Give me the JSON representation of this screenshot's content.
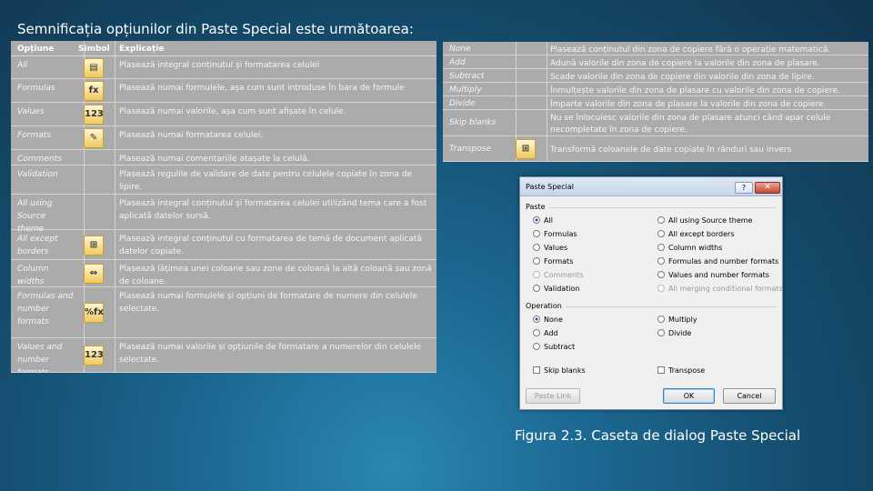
{
  "title": "Semnificația opțiunilor din Paste Special este următoarea:",
  "caption": "Figura 2.3. Caseta de dialog Paste Special",
  "left_table": {
    "headers": {
      "option": "Opțiune",
      "symbol": "Simbol",
      "explanation": "Explicație"
    },
    "rows": [
      {
        "option": "All",
        "icon": "paste-all-icon",
        "glyph": "▤",
        "explanation": "Plasează integral conținutul și formatarea celulei"
      },
      {
        "option": "Formulas",
        "icon": "paste-formulas-icon",
        "glyph": "fx",
        "explanation": "Plasează numai formulele, așa cum sunt introduse în bara de formule"
      },
      {
        "option": "Values",
        "icon": "paste-values-icon",
        "glyph": "123",
        "explanation": "Plasează numai valorile, așa cum sunt afișate în celule."
      },
      {
        "option": "Formats",
        "icon": "paste-formats-icon",
        "glyph": "✎",
        "explanation": "Plasează numai formatarea celulei."
      },
      {
        "option": "Comments",
        "icon": "",
        "glyph": "",
        "explanation": "Plasează numai comentariile atașate la celulă."
      },
      {
        "option": "Validation",
        "icon": "",
        "glyph": "",
        "explanation": "Plasează regulile de validare de date pentru celulele copiate în zona de lipire."
      },
      {
        "option": "All using Source theme",
        "icon": "",
        "glyph": "",
        "explanation": "Plasează integral conținutul și formatarea celulei utilizând tema care a fost aplicată datelor sursă."
      },
      {
        "option": "All except borders",
        "icon": "paste-no-borders-icon",
        "glyph": "⊞",
        "explanation": "Plasează integral conținutul cu formatarea de temă de document aplicată datelor copiate."
      },
      {
        "option": "Column widths",
        "icon": "paste-column-widths-icon",
        "glyph": "⇔",
        "explanation": "Plasează lățimea unei coloane sau zone de coloană la altă coloană sau zonă de coloane."
      },
      {
        "option": "Formulas and number formats",
        "icon": "paste-formulas-number-formats-icon",
        "glyph": "%fx",
        "explanation": "Plasează numai formulele și opțiuni de formatare de numere din celulele selectate."
      },
      {
        "option": "Values and number formats",
        "icon": "paste-values-number-formats-icon",
        "glyph": "123",
        "explanation": "Plasează numai valorile și opțiunile de formatare a numerelor din celulele selectate."
      }
    ]
  },
  "right_table": {
    "rows": [
      {
        "option": "None",
        "icon": "",
        "glyph": "",
        "explanation": "Plasează conținutul din zona de copiere fără o operație matematică."
      },
      {
        "option": "Add",
        "icon": "",
        "glyph": "",
        "explanation": "Adună valorile din zona de copiere la valorile din zona de plasare."
      },
      {
        "option": "Subtract",
        "icon": "",
        "glyph": "",
        "explanation": "Scade valorile din zona de copiere din valorile din zona de lipire."
      },
      {
        "option": "Multiply",
        "icon": "",
        "glyph": "",
        "explanation": "Înmulțește valorile din zona de plasare cu valorile din zona de copiere."
      },
      {
        "option": "Divide",
        "icon": "",
        "glyph": "",
        "explanation": "Împarte valorile din zona de plasare la valorile din zona de copiere."
      },
      {
        "option": "Skip blanks",
        "icon": "",
        "glyph": "",
        "explanation": "Nu se înlocuiesc valorile din zona de plasare atunci când apar celule necompletate în zona de copiere."
      },
      {
        "option": "Transpose",
        "icon": "transpose-icon",
        "glyph": "⊞",
        "explanation": "Transformă coloanele de date copiate în rânduri sau invers"
      }
    ]
  },
  "dialog": {
    "title": "Paste Special",
    "help_label": "?",
    "close_label": "✕",
    "paste_group_label": "Paste",
    "operation_group_label": "Operation",
    "paste_col1": [
      {
        "label": "All",
        "checked": true,
        "disabled": false
      },
      {
        "label": "Formulas",
        "checked": false,
        "disabled": false
      },
      {
        "label": "Values",
        "checked": false,
        "disabled": false
      },
      {
        "label": "Formats",
        "checked": false,
        "disabled": false
      },
      {
        "label": "Comments",
        "checked": false,
        "disabled": true
      },
      {
        "label": "Validation",
        "checked": false,
        "disabled": false
      }
    ],
    "paste_col2": [
      {
        "label": "All using Source theme",
        "checked": false,
        "disabled": false
      },
      {
        "label": "All except borders",
        "checked": false,
        "disabled": false
      },
      {
        "label": "Column widths",
        "checked": false,
        "disabled": false
      },
      {
        "label": "Formulas and number formats",
        "checked": false,
        "disabled": false
      },
      {
        "label": "Values and number formats",
        "checked": false,
        "disabled": false
      },
      {
        "label": "All merging conditional formats",
        "checked": false,
        "disabled": true
      }
    ],
    "op_col1": [
      {
        "label": "None",
        "checked": true
      },
      {
        "label": "Add",
        "checked": false
      },
      {
        "label": "Subtract",
        "checked": false
      }
    ],
    "op_col2": [
      {
        "label": "Multiply",
        "checked": false
      },
      {
        "label": "Divide",
        "checked": false
      }
    ],
    "skip_blanks_label": "Skip blanks",
    "transpose_label": "Transpose",
    "paste_link_label": "Paste Link",
    "ok_label": "OK",
    "cancel_label": "Cancel"
  },
  "colors": {
    "background": "#154d6e",
    "table_bg": "#ababab",
    "dialog_bg": "#f0f0f0"
  }
}
